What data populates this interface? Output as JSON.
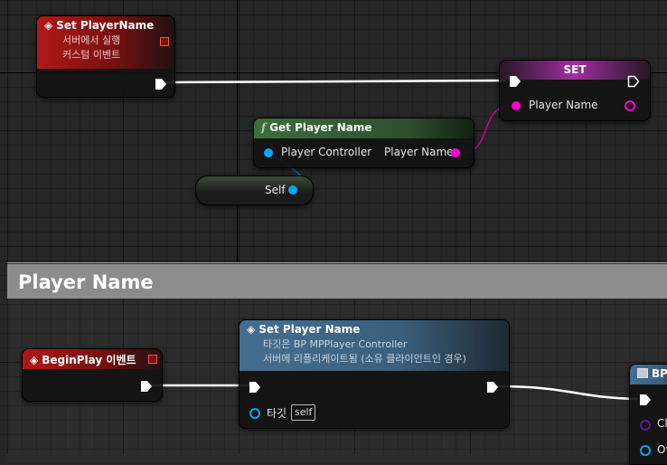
{
  "set_event_node": {
    "title": "Set PlayerName",
    "subtitle_line1": "서버에서 실행",
    "subtitle_line2": "커스텀 이벤트"
  },
  "set_var_node": {
    "title": "SET",
    "pin_label": "Player Name"
  },
  "get_player_name_node": {
    "title": "Get Player Name",
    "input_label": "Player Controller",
    "output_label": "Player Name"
  },
  "self_node": {
    "label": "Self"
  },
  "comment_box": {
    "title": "Player Name"
  },
  "begin_play_node": {
    "title": "BeginPlay 이벤트"
  },
  "set_player_name_call": {
    "title": "Set Player Name",
    "subtitle_line1": "타깃은 BP MPPlayer Controller",
    "subtitle_line2": "서버에 리플리케이트됨 (소유 클라이언트인 경우)",
    "target_label": "타깃",
    "target_value": "self"
  },
  "bp_node_partial": {
    "title": "BP",
    "pin1_label": "Cl",
    "pin2_label": "Ov"
  },
  "colors": {
    "exec_wire": "#ffffff",
    "string_pin": "#ff00d4",
    "object_pin": "#00a8f3",
    "event_header": "#b01818",
    "function_header": "#3d6e3d",
    "call_header": "#456e90",
    "comment_header": "#8c8c8c"
  }
}
